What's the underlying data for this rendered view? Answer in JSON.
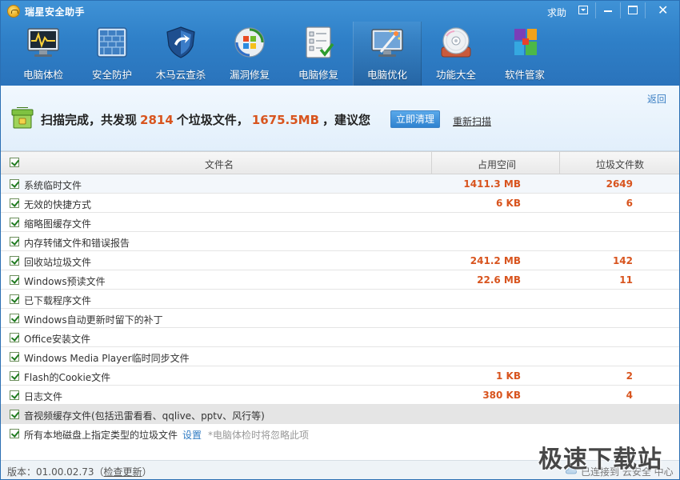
{
  "window": {
    "title": "瑞星安全助手",
    "help_label": "求助"
  },
  "toolbar": {
    "items": [
      {
        "label": "电脑体检",
        "icon": "monitor-checkup-icon"
      },
      {
        "label": "安全防护",
        "icon": "firewall-icon"
      },
      {
        "label": "木马云查杀",
        "icon": "shield-icon"
      },
      {
        "label": "漏洞修复",
        "icon": "windows-update-icon"
      },
      {
        "label": "电脑修复",
        "icon": "checklist-icon"
      },
      {
        "label": "电脑优化",
        "icon": "optimize-wand-icon"
      },
      {
        "label": "功能大全",
        "icon": "disc-icon"
      },
      {
        "label": "软件管家",
        "icon": "software-blocks-icon"
      }
    ],
    "active_index": 5
  },
  "summary": {
    "back_label": "返回",
    "prefix": "扫描完成，共发现",
    "file_count": "2814",
    "middle": "个垃圾文件，",
    "total_size": "1675.5MB",
    "suffix": "，建议您",
    "clean_button": "立即清理",
    "rescan_link": "重新扫描"
  },
  "table": {
    "headers": {
      "name": "文件名",
      "size": "占用空间",
      "count": "垃圾文件数"
    },
    "rows": [
      {
        "name": "系统临时文件",
        "size": "1411.3 MB",
        "count": "2649",
        "checked": true
      },
      {
        "name": "无效的快捷方式",
        "size": "6 KB",
        "count": "6",
        "checked": true
      },
      {
        "name": "缩略图缓存文件",
        "size": "",
        "count": "",
        "checked": true
      },
      {
        "name": "内存转储文件和错误报告",
        "size": "",
        "count": "",
        "checked": true
      },
      {
        "name": "回收站垃圾文件",
        "size": "241.2 MB",
        "count": "142",
        "checked": true
      },
      {
        "name": "Windows预读文件",
        "size": "22.6 MB",
        "count": "11",
        "checked": true
      },
      {
        "name": "已下载程序文件",
        "size": "",
        "count": "",
        "checked": true
      },
      {
        "name": "Windows自动更新时留下的补丁",
        "size": "",
        "count": "",
        "checked": true
      },
      {
        "name": "Office安装文件",
        "size": "",
        "count": "",
        "checked": true
      },
      {
        "name": "Windows Media Player临时同步文件",
        "size": "",
        "count": "",
        "checked": true
      },
      {
        "name": "Flash的Cookie文件",
        "size": "1 KB",
        "count": "2",
        "checked": true
      },
      {
        "name": "日志文件",
        "size": "380 KB",
        "count": "4",
        "checked": true
      },
      {
        "name": "音视频缓存文件(包括迅雷看看、qqlive、pptv、风行等)",
        "size": "",
        "count": "",
        "checked": true
      }
    ],
    "disk_row": {
      "name": "所有本地磁盘上指定类型的垃圾文件",
      "setting_link": "设置",
      "hint": "*电脑体检时将忽略此项",
      "checked": true
    }
  },
  "statusbar": {
    "version": "版本：01.00.02.73",
    "update_open": "（",
    "update_link": "检查更新",
    "update_close": "）",
    "cloud_status": "已连接到  云安全  中心"
  },
  "watermark": "极速下载站",
  "colors": {
    "titlebar": "#2f80c8",
    "accent_orange": "#d8541e",
    "link_blue": "#3b7fc4"
  }
}
